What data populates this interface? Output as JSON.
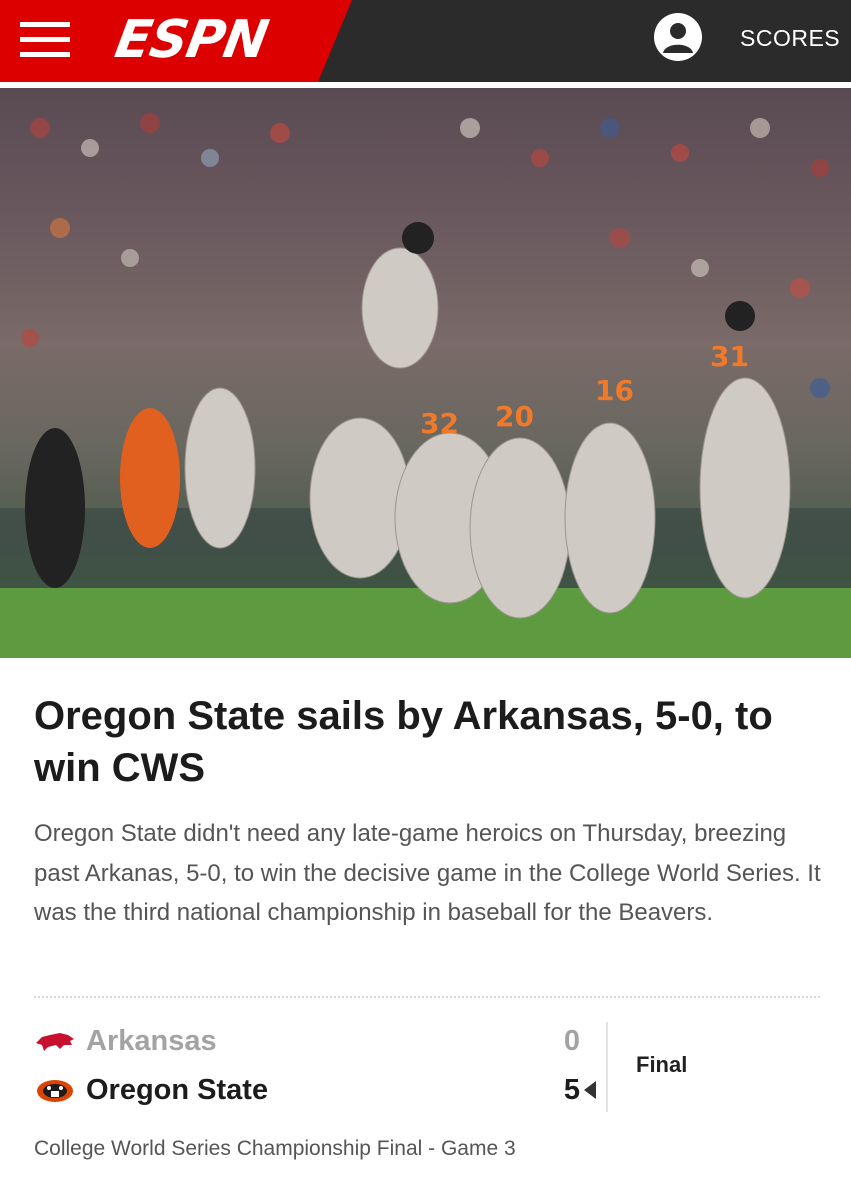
{
  "header": {
    "logo_text": "ESPN",
    "scores_label": "SCORES",
    "menu_icon": "hamburger-menu-icon",
    "user_icon": "user-profile-icon",
    "brand_color": "#dd0000",
    "bar_color": "#2b2b2b"
  },
  "article": {
    "headline": "Oregon State sails by Arkansas, 5-0, to win CWS",
    "summary": "Oregon State didn't need any late-game heroics on Thursday, breezing past Arkanas, 5-0, to win the decisive game in the College World Series. It was the third national championship in baseball for the Beavers."
  },
  "scoreboard": {
    "away": {
      "name": "Arkansas",
      "score": "0",
      "logo_icon": "razorback-logo-icon",
      "color": "#c8102e"
    },
    "home": {
      "name": "Oregon State",
      "score": "5",
      "logo_icon": "beaver-logo-icon",
      "color": "#dc4405",
      "winner": true
    },
    "status": "Final",
    "description": "College World Series Championship Final - Game 3"
  },
  "photo": {
    "jersey_numbers": [
      "31",
      "32",
      "20",
      "16"
    ]
  }
}
